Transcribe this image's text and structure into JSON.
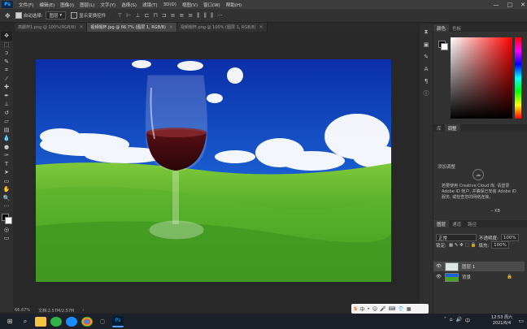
{
  "app": {
    "logo": "Ps"
  },
  "menu": [
    "文件(F)",
    "编辑(E)",
    "图像(I)",
    "图层(L)",
    "文字(Y)",
    "选择(S)",
    "滤镜(T)",
    "3D(D)",
    "视图(V)",
    "窗口(W)",
    "帮助(H)"
  ],
  "window_controls": {
    "minimize": "—",
    "maximize": "□",
    "close": "✕"
  },
  "options": {
    "auto_select_label": "自动选择:",
    "auto_select_value": "图层",
    "show_transform_label": "显示变换控件"
  },
  "tabs": [
    {
      "label": "高脚杯1.png @ 100%(RGB/8)",
      "active": false
    },
    {
      "label": "视频帽杯.jpg @ 66.7% (图层 1, RGB/8)",
      "active": true
    },
    {
      "label": "视频帽杯.png @ 100% (图层 1, RGB/8)",
      "active": false
    }
  ],
  "status": {
    "zoom": "66.67%",
    "doc": "文档:2.57M/2.57M"
  },
  "color_panel": {
    "tabs": [
      "颜色",
      "色板"
    ]
  },
  "adjust_panel": {
    "tabs": [
      "库",
      "调整"
    ],
    "heading": "添加调整",
    "message": "若要使用 Creative Cloud 库, 请登录 Adobe ID 帐户, 并确保已安装 Adobe ID 服务, 或检查您的网络连接。",
    "size": "-- KB"
  },
  "layers_panel": {
    "tabs": [
      "图层",
      "通道",
      "路径"
    ],
    "kind": "正常",
    "opacity_label": "不透明度:",
    "opacity": "100%",
    "lock_label": "锁定:",
    "fill_label": "填充:",
    "fill": "100%",
    "layers": [
      {
        "name": "图层 1",
        "selected": true
      },
      {
        "name": "背景",
        "selected": false
      }
    ]
  },
  "ime": {
    "label": "中"
  },
  "clock": {
    "time": "12:53 周六",
    "date": "2021/6/4"
  }
}
